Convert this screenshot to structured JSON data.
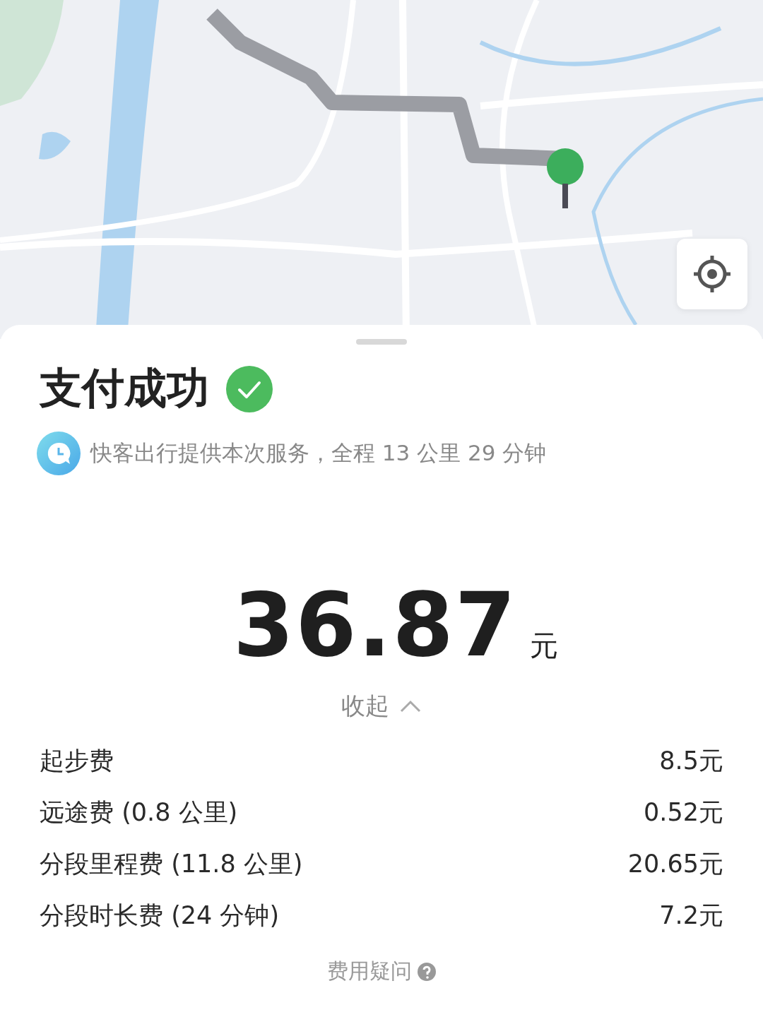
{
  "sheet": {
    "title": "支付成功",
    "paid": true,
    "provider_note": "快客出行提供本次服务，全程 13 公里 29 分钟"
  },
  "fare": {
    "amount": "36.87",
    "unit": "元"
  },
  "breakdown": {
    "toggle_label": "收起",
    "expanded": true,
    "items": [
      {
        "label": "起步费",
        "value": "8.5元"
      },
      {
        "label": "远途费 (0.8 公里)",
        "value": "0.52元"
      },
      {
        "label": "分段里程费 (11.8 公里)",
        "value": "20.65元"
      },
      {
        "label": "分段时长费 (24 分钟)",
        "value": "7.2元"
      }
    ]
  },
  "help_link": "费用疑问"
}
